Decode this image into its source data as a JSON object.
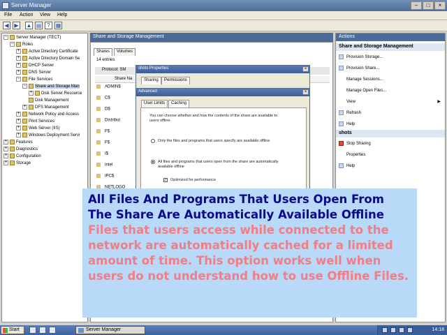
{
  "window": {
    "title": "Server Manager"
  },
  "menu": [
    "File",
    "Action",
    "View",
    "Help"
  ],
  "tree": [
    {
      "label": "Server Manager (TECT)",
      "indent": 0,
      "exp": "−"
    },
    {
      "label": "Roles",
      "indent": 1,
      "exp": "−"
    },
    {
      "label": "Active Directory Certificate",
      "indent": 2,
      "exp": "+"
    },
    {
      "label": "Active Directory Domain Se",
      "indent": 2,
      "exp": "+"
    },
    {
      "label": "DHCP Server",
      "indent": 2,
      "exp": "+"
    },
    {
      "label": "DNS Server",
      "indent": 2,
      "exp": "+"
    },
    {
      "label": "File Services",
      "indent": 2,
      "exp": "−"
    },
    {
      "label": "Share and Storage Man",
      "indent": 3,
      "exp": "−",
      "selected": true
    },
    {
      "label": "Disk Server Resource",
      "indent": 4,
      "exp": "+"
    },
    {
      "label": "Disk Management",
      "indent": 4,
      "exp": ""
    },
    {
      "label": "DFS Management",
      "indent": 3,
      "exp": "+"
    },
    {
      "label": "Network Policy and Access",
      "indent": 2,
      "exp": "+"
    },
    {
      "label": "Print Services",
      "indent": 2,
      "exp": "+"
    },
    {
      "label": "Web Server (IIS)",
      "indent": 2,
      "exp": "+"
    },
    {
      "label": "Windows Deployment Servi",
      "indent": 2,
      "exp": "+"
    },
    {
      "label": "Features",
      "indent": 0,
      "exp": "+"
    },
    {
      "label": "Diagnostics",
      "indent": 0,
      "exp": "+"
    },
    {
      "label": "Configuration",
      "indent": 0,
      "exp": "+"
    },
    {
      "label": "Storage",
      "indent": 0,
      "exp": "+"
    }
  ],
  "center": {
    "header": "Share and Storage Management",
    "tabs": [
      "Shares",
      "Volumes"
    ],
    "entries": "14 entries",
    "protocol": "Protocol: SM",
    "column": "Share Na",
    "rows": [
      "ADMIN$",
      "C$",
      "D$",
      "Distribut",
      "F$",
      "F$",
      "I$",
      "Intel",
      "IPC$",
      "NETLOGO"
    ]
  },
  "actions": {
    "title": "Actions",
    "group1": "Share and Storage Management",
    "items1": [
      "Provision Storage...",
      "Provision Share...",
      "Manage Sessions...",
      "Manage Open Files...",
      "View",
      "Refresh",
      "Help"
    ],
    "group2": "shots",
    "items2": [
      "Stop Sharing",
      "Properties",
      "Help"
    ]
  },
  "dlg_props": {
    "title": "shots Properties",
    "tabs": [
      "Sharing",
      "Permissions"
    ]
  },
  "dlg_adv": {
    "title": "Advanced",
    "tabs": [
      "User Limits",
      "Caching"
    ],
    "desc": "You can choose whether and how the contents of the share are available to users offline.",
    "opt1": "Only the files and programs that users specify are available offline",
    "opt2": "All files and programs that users open from the share are automatically available offline",
    "opt3": "Optimized for performance"
  },
  "caption": {
    "heading": "All Files And Programs That Users Open From The Share Are Automatically Available Offline",
    "body": "Files that users access while connected to the network are automatically cached for a limited amount of time. This option works well when users do not understand how to use Offline Files."
  },
  "taskbar": {
    "start": "Start",
    "task": "Server Manager",
    "clock": "14:18"
  }
}
